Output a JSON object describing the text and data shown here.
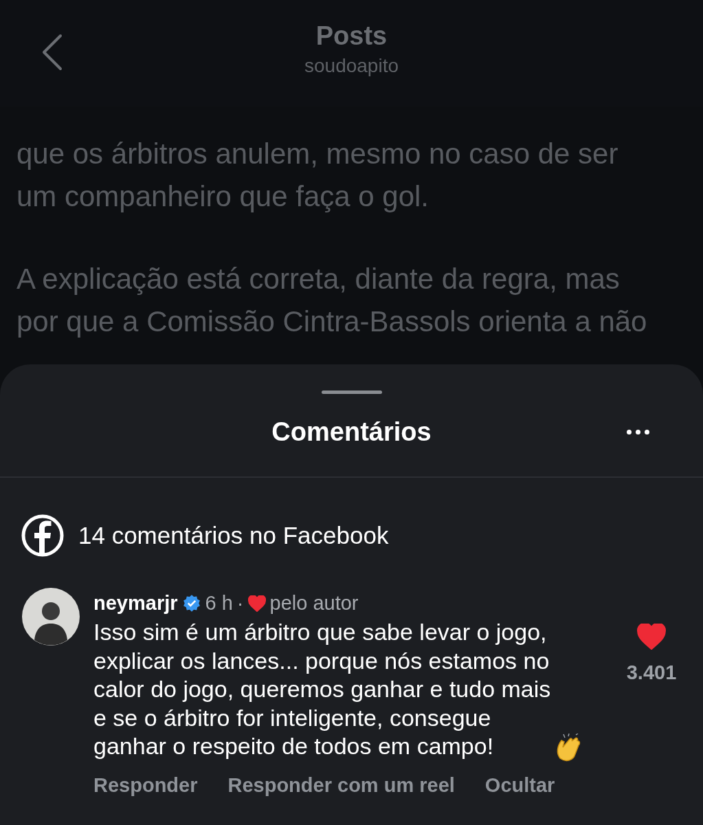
{
  "header": {
    "title": "Posts",
    "subtitle": "soudoapito"
  },
  "post": {
    "paragraphs": [
      [
        "que os árbitros anulem, mesmo no caso de ser",
        "um companheiro que faça o gol."
      ],
      [
        "A explicação está correta, diante da regra, mas",
        "por que a Comissão Cintra-Bassols orienta a não"
      ]
    ]
  },
  "sheet": {
    "title": "Comentários",
    "facebook_count": "14 comentários no Facebook",
    "comments": [
      {
        "author": "neymarjr",
        "verified": true,
        "time": "6 h",
        "separator": "·",
        "liked_by_author": true,
        "author_like_label": "pelo autor",
        "body_lines": [
          "Isso sim é um árbitro que sabe levar o jogo,",
          "explicar os lances... porque nós estamos no",
          "calor do jogo, queremos ganhar e tudo mais",
          "e se o árbitro for inteligente, consegue",
          "ganhar o respeito de todos em campo!"
        ],
        "liked": true,
        "likes": "3.401",
        "actions": [
          "Responder",
          "Responder com um reel",
          "Ocultar"
        ]
      }
    ]
  }
}
